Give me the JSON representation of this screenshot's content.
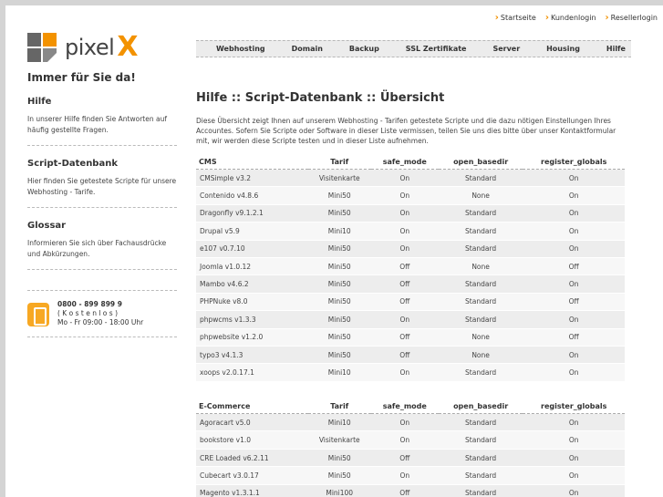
{
  "top_links": [
    "Startseite",
    "Kundenlogin",
    "Resellerlogin"
  ],
  "logo": {
    "word": "pixel",
    "x": "X"
  },
  "nav": [
    "Webhosting",
    "Domain",
    "Backup",
    "SSL Zertifikate",
    "Server",
    "Housing",
    "Hilfe"
  ],
  "sidebar": {
    "tagline": "Immer für Sie da!",
    "sections": [
      {
        "title": "Hilfe",
        "text": "In unserer Hilfe finden Sie Antworten auf häufig gestellte Fragen."
      },
      {
        "title": "Script-Datenbank",
        "text": "Hier finden Sie getestete Scripte für unsere Webhosting - Tarife."
      },
      {
        "title": "Glossar",
        "text": "Informieren Sie sich über Fachausdrücke und Abkürzungen."
      }
    ],
    "contact": {
      "phone": "0800 - 899 899 9",
      "free": "( K o s t e n l o s )",
      "hours": "Mo - Fr  09:00 - 18:00 Uhr"
    }
  },
  "content": {
    "title": "Hilfe :: Script-Datenbank :: Übersicht",
    "intro": "Diese Übersicht zeigt Ihnen auf unserem Webhosting - Tarifen getestete Scripte und die dazu nötigen Einstellungen Ihres Accountes. Sofern Sie Scripte oder Software in dieser Liste vermissen, teilen Sie uns dies bitte über unser Kontaktformular mit, wir werden diese Scripte testen und in dieser Liste aufnehmen.",
    "headers_rest": [
      "Tarif",
      "safe_mode",
      "open_basedir",
      "register_globals"
    ],
    "groups": [
      {
        "name": "CMS",
        "rows": [
          [
            "CMSimple v3.2",
            "Visitenkarte",
            "On",
            "Standard",
            "On"
          ],
          [
            "Contenido v4.8.6",
            "Mini50",
            "On",
            "None",
            "On"
          ],
          [
            "Dragonfly v9.1.2.1",
            "Mini50",
            "On",
            "Standard",
            "On"
          ],
          [
            "Drupal v5.9",
            "Mini10",
            "On",
            "Standard",
            "On"
          ],
          [
            "e107 v0.7.10",
            "Mini50",
            "On",
            "Standard",
            "On"
          ],
          [
            "Joomla v1.0.12",
            "Mini50",
            "Off",
            "None",
            "Off"
          ],
          [
            "Mambo v4.6.2",
            "Mini50",
            "Off",
            "Standard",
            "On"
          ],
          [
            "PHPNuke v8.0",
            "Mini50",
            "Off",
            "Standard",
            "Off"
          ],
          [
            "phpwcms v1.3.3",
            "Mini50",
            "On",
            "Standard",
            "On"
          ],
          [
            "phpwebsite v1.2.0",
            "Mini50",
            "Off",
            "None",
            "Off"
          ],
          [
            "typo3 v4.1.3",
            "Mini50",
            "Off",
            "None",
            "On"
          ],
          [
            "xoops v2.0.17.1",
            "Mini10",
            "On",
            "Standard",
            "On"
          ]
        ]
      },
      {
        "name": "E-Commerce",
        "rows": [
          [
            "Agoracart v5.0",
            "Mini10",
            "On",
            "Standard",
            "On"
          ],
          [
            "bookstore v1.0",
            "Visitenkarte",
            "On",
            "Standard",
            "On"
          ],
          [
            "CRE Loaded v6.2.11",
            "Mini50",
            "Off",
            "Standard",
            "On"
          ],
          [
            "Cubecart v3.0.17",
            "Mini50",
            "On",
            "Standard",
            "On"
          ],
          [
            "Magento v1.3.1.1",
            "Mini100",
            "Off",
            "Standard",
            "On"
          ]
        ]
      }
    ]
  },
  "colors": {
    "accent": "#f39200",
    "nav_bg": "#ececec",
    "row_odd": "#ededed",
    "row_even": "#f7f7f7"
  }
}
